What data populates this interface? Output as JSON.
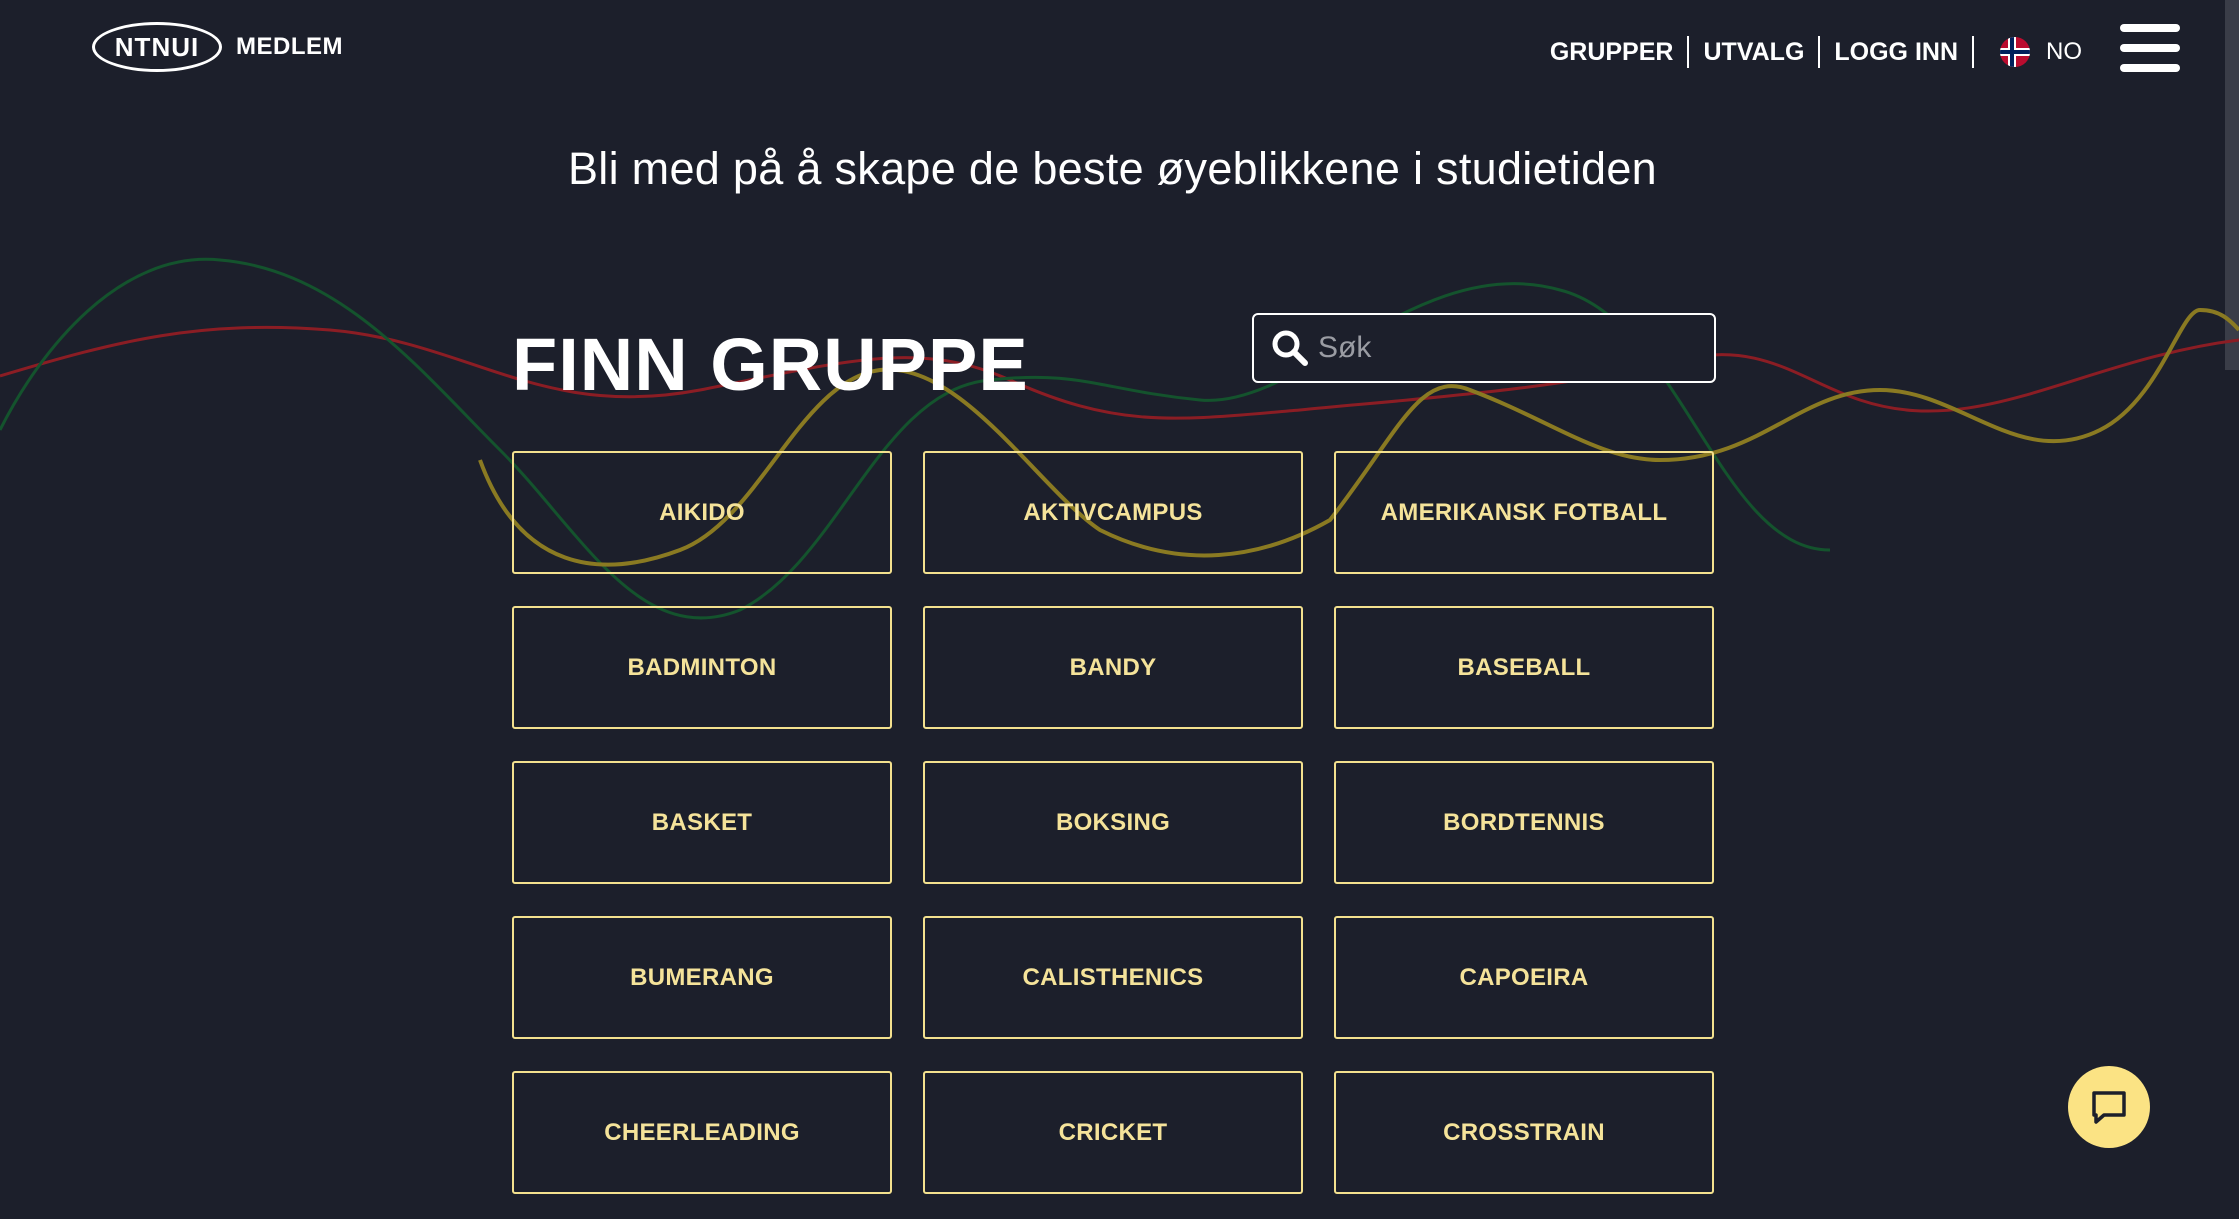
{
  "brand": {
    "logo_text": "NTNUI",
    "subtitle": "MEDLEM"
  },
  "nav": {
    "links": [
      "GRUPPER",
      "UTVALG",
      "LOGG INN"
    ],
    "language": "NO",
    "menu_icon": "hamburger-menu-icon"
  },
  "hero": {
    "tagline": "Bli med på å skape de beste øyeblikkene i studietiden"
  },
  "finder": {
    "title": "FINN GRUPPE",
    "search_placeholder": "Søk",
    "search_value": "",
    "search_icon": "search-icon"
  },
  "groups": [
    "AIKIDO",
    "AKTIVCAMPUS",
    "AMERIKANSK FOTBALL",
    "BADMINTON",
    "BANDY",
    "BASEBALL",
    "BASKET",
    "BOKSING",
    "BORDTENNIS",
    "BUMERANG",
    "CALISTHENICS",
    "CAPOEIRA",
    "CHEERLEADING",
    "CRICKET",
    "CROSSTRAIN"
  ],
  "chat": {
    "icon": "chat-bubble-icon"
  },
  "colors": {
    "background": "#1c1f2b",
    "accent": "#f5e39a",
    "chat_button": "#fbe384",
    "wave_red": "#8b1d24",
    "wave_green": "#14532d",
    "wave_olive": "#8a7a22"
  }
}
